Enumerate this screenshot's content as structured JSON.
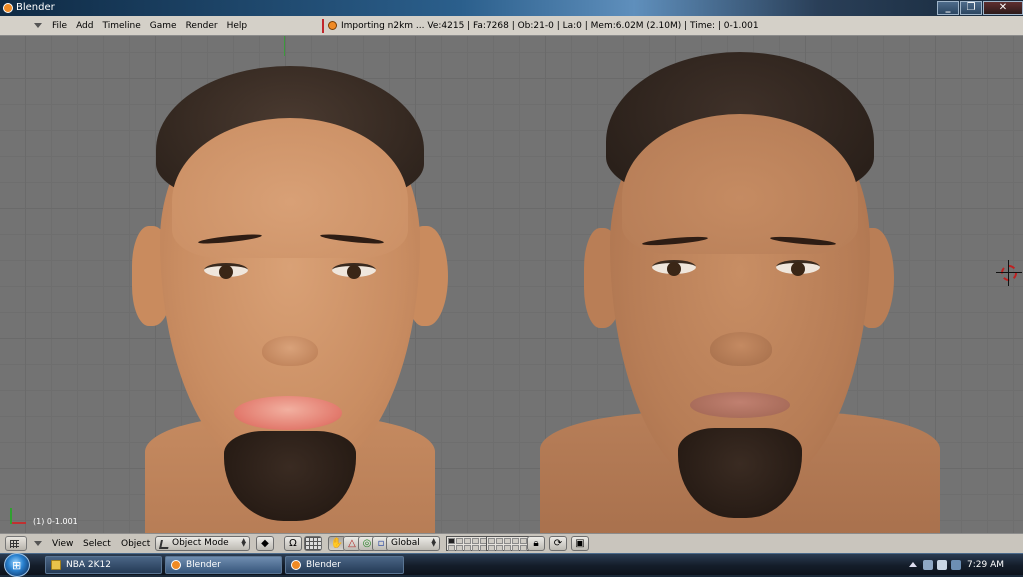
{
  "window": {
    "title": "Blender",
    "minimize": "_",
    "restore": "❐",
    "close": "✕"
  },
  "info_header": {
    "menu": [
      "File",
      "Add",
      "Timeline",
      "Game",
      "Render",
      "Help"
    ],
    "status": "Importing n2km ...   Ve:4215 | Fa:7268 | Ob:21-0 | La:0   | Mem:6.02M (2.10M)  | Time: | 0-1.001"
  },
  "viewport": {
    "frame_label": "(1) 0-1.001"
  },
  "view_header": {
    "menu": [
      "View",
      "Select",
      "Object"
    ],
    "mode": "Object Mode",
    "orientation": "Global"
  },
  "taskbar": {
    "start_glyph": "⊞",
    "tasks": [
      "NBA 2K12",
      "Blender",
      "Blender"
    ],
    "clock": "7:29 AM"
  },
  "colors": {
    "viewport_bg": "#737373",
    "header_bg": "#d4d0c8",
    "blender_orange": "#f08a24"
  },
  "icons": [
    "blender-icon",
    "grid-icon",
    "hand-icon",
    "pin-icon",
    "lock-icon",
    "render-icon",
    "folder-icon",
    "speaker-icon",
    "network-icon"
  ]
}
